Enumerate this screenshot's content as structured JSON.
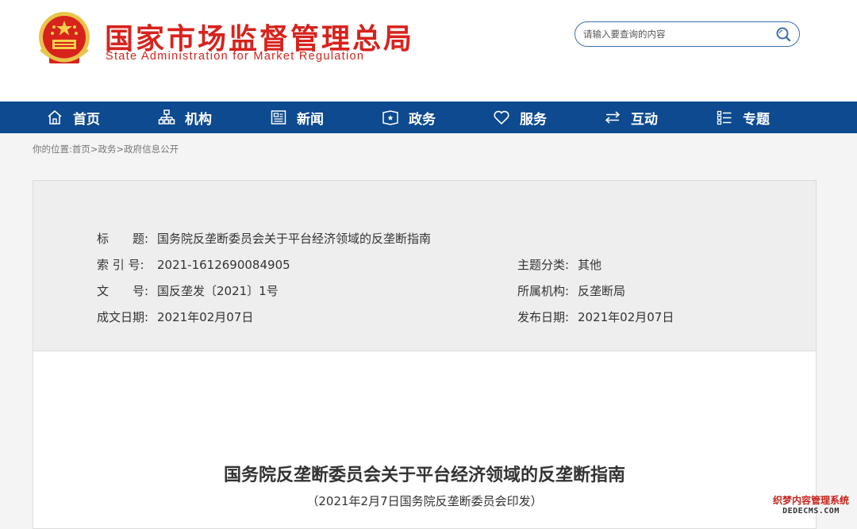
{
  "header": {
    "org_name_cn": "国家市场监督管理总局",
    "org_name_en": "State Administration for Market Regulation",
    "emblem_icon": "national-emblem-icon",
    "brand_color": "#d7231c",
    "search": {
      "placeholder": "请输入要查询的内容",
      "value": "",
      "icon": "search-icon"
    }
  },
  "nav": {
    "background": "#0d4a8f",
    "items": [
      {
        "label": "首页",
        "icon": "home-icon"
      },
      {
        "label": "机构",
        "icon": "org-chart-icon"
      },
      {
        "label": "新闻",
        "icon": "newspaper-icon"
      },
      {
        "label": "政务",
        "icon": "government-icon"
      },
      {
        "label": "服务",
        "icon": "heart-icon"
      },
      {
        "label": "互动",
        "icon": "exchange-arrows-icon"
      },
      {
        "label": "专题",
        "icon": "topics-list-icon"
      }
    ]
  },
  "breadcrumb": {
    "prefix": "你的位置:",
    "items": [
      "首页",
      "政务",
      "政府信息公开"
    ],
    "separator": ">"
  },
  "doc_meta": {
    "title": {
      "label": "标　　题:",
      "value": "国务院反垄断委员会关于平台经济领域的反垄断指南"
    },
    "index_no": {
      "label": "索 引 号:",
      "value": "2021-1612690084905"
    },
    "doc_no": {
      "label": "文　　号:",
      "value": "国反垄发〔2021〕1号"
    },
    "created_date": {
      "label": "成文日期:",
      "value": "2021年02月07日"
    },
    "category": {
      "label": "主题分类:",
      "value": "其他"
    },
    "agency": {
      "label": "所属机构:",
      "value": "反垄断局"
    },
    "published_date": {
      "label": "发布日期:",
      "value": "2021年02月07日"
    }
  },
  "document": {
    "title": "国务院反垄断委员会关于平台经济领域的反垄断指南",
    "subtitle": "（2021年2月7日国务院反垄断委员会印发）"
  },
  "watermark": {
    "line1": "织梦内容管理系统",
    "line2": "DEDECMS.COM"
  }
}
